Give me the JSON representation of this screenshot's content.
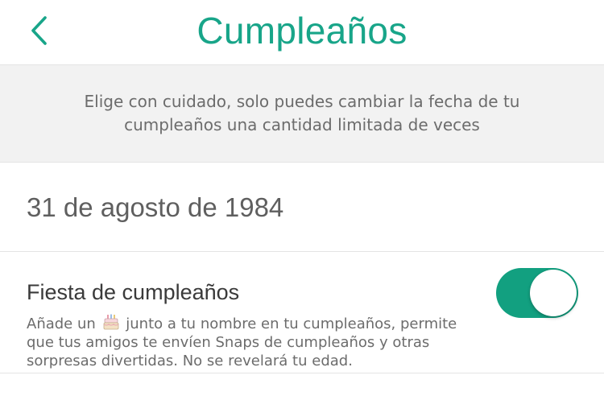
{
  "header": {
    "title": "Cumpleaños",
    "back_icon": "chevron-left-icon"
  },
  "info": {
    "text": "Elige con cuidado, solo puedes cambiar la fecha de tu cumpleaños una cantidad limitada de veces"
  },
  "birthday": {
    "date": "31 de agosto de 1984"
  },
  "party": {
    "title": "Fiesta de cumpleaños",
    "desc_before_icon": "Añade un",
    "icon": "cake-icon",
    "desc_after_icon": "junto a tu nombre en tu cumpleaños, permite que tus amigos te envíen Snaps de cumpleaños y otras sorpresas divertidas. No se revelará tu edad.",
    "toggle_on": true
  },
  "colors": {
    "accent": "#18a589",
    "toggle_on": "#12a080",
    "banner_bg": "#f2f2f2",
    "muted_text": "#6c6c6c"
  }
}
